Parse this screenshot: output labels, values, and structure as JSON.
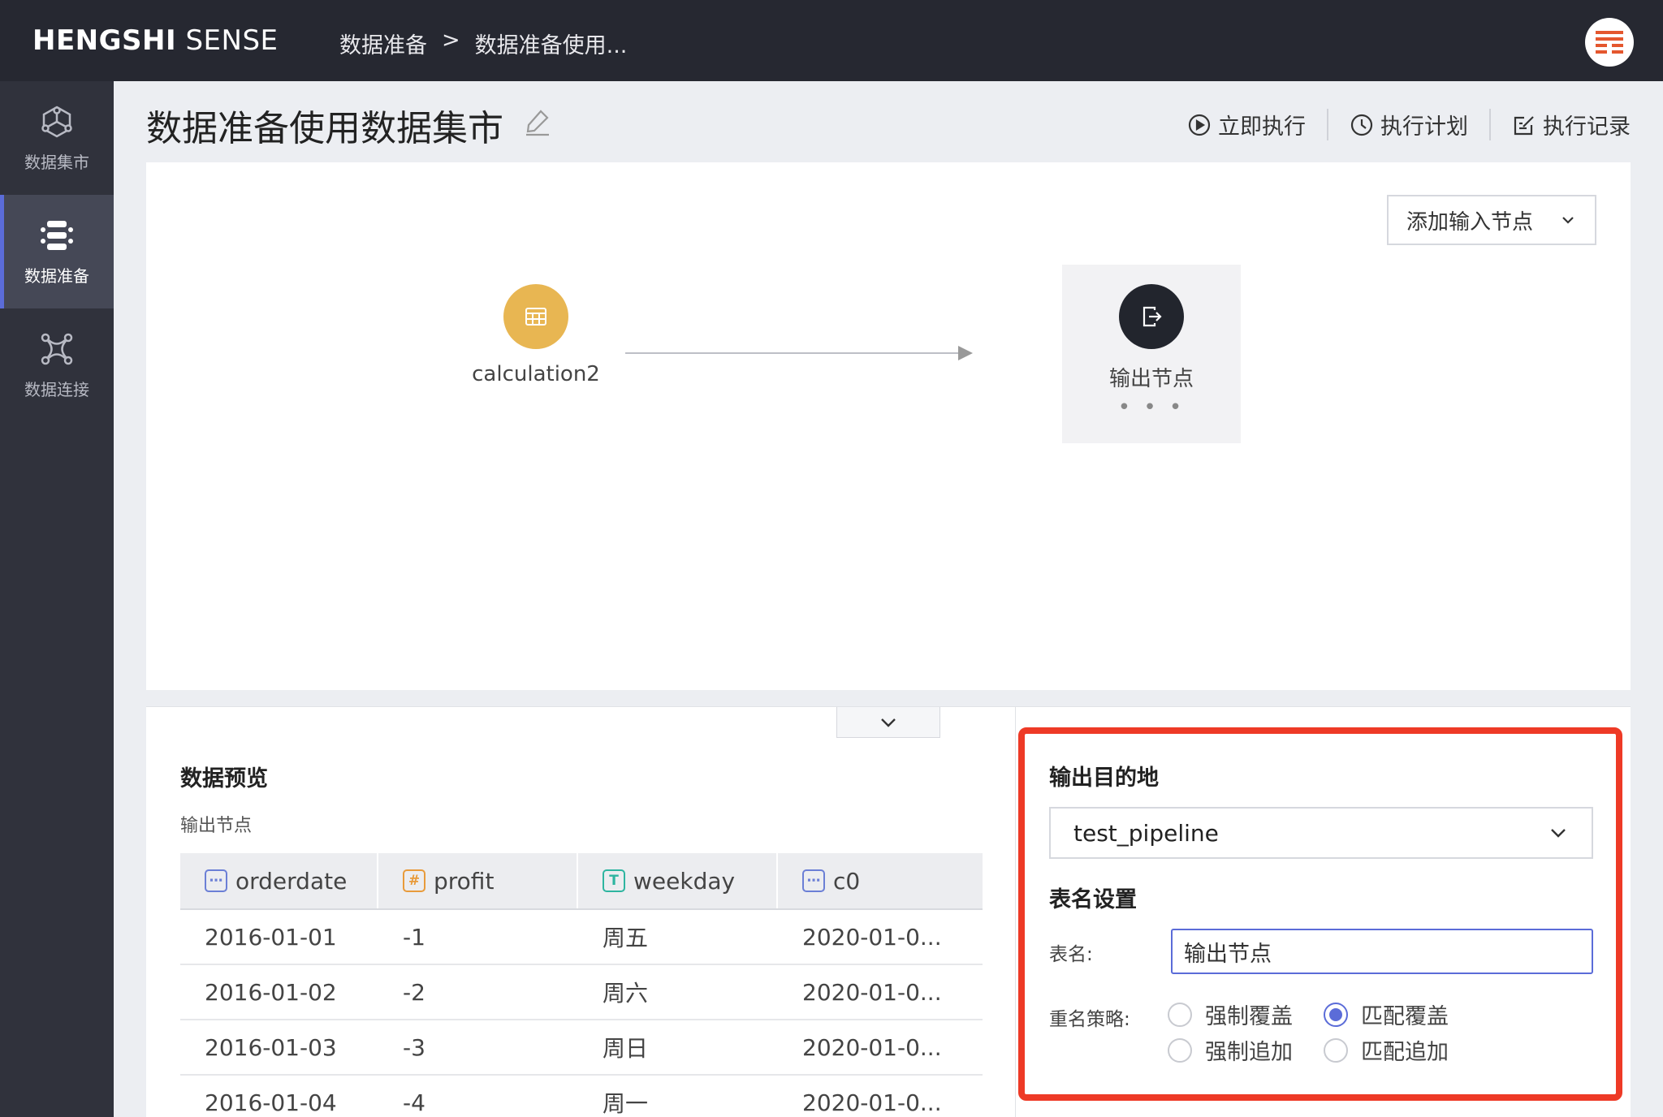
{
  "header": {
    "logo_bold": "HENGSHI",
    "logo_light": " SENSE",
    "breadcrumb": [
      "数据准备",
      ">",
      "数据准备使用..."
    ]
  },
  "sidebar": {
    "items": [
      {
        "label": "数据集市",
        "icon": "data-mart-icon",
        "active": false
      },
      {
        "label": "数据准备",
        "icon": "data-prep-icon",
        "active": true
      },
      {
        "label": "数据连接",
        "icon": "data-connect-icon",
        "active": false
      }
    ]
  },
  "page": {
    "title": "数据准备使用数据集市",
    "actions": {
      "run_now": "立即执行",
      "schedule": "执行计划",
      "history": "执行记录"
    }
  },
  "canvas": {
    "add_input_node": "添加输入节点",
    "nodes": {
      "calc_label": "calculation2",
      "output_label": "输出节点",
      "output_more": "• • •"
    }
  },
  "preview": {
    "title": "数据预览",
    "subtitle": "输出节点",
    "columns": [
      {
        "name": "orderdate",
        "type": "date",
        "type_glyph": "⋯"
      },
      {
        "name": "profit",
        "type": "number",
        "type_glyph": "#"
      },
      {
        "name": "weekday",
        "type": "text",
        "type_glyph": "T"
      },
      {
        "name": "c0",
        "type": "date",
        "type_glyph": "⋯"
      }
    ],
    "rows": [
      [
        "2016-01-01",
        "-1",
        "周五",
        "2020-01-0..."
      ],
      [
        "2016-01-02",
        "-2",
        "周六",
        "2020-01-0..."
      ],
      [
        "2016-01-03",
        "-3",
        "周日",
        "2020-01-0..."
      ],
      [
        "2016-01-04",
        "-4",
        "周一",
        "2020-01-0..."
      ]
    ]
  },
  "settings": {
    "destination_title": "输出目的地",
    "destination_value": "test_pipeline",
    "table_title": "表名设置",
    "table_name_label": "表名:",
    "table_name_value": "输出节点",
    "strategy_label": "重名策略:",
    "strategies": [
      {
        "label": "强制覆盖",
        "selected": false
      },
      {
        "label": "匹配覆盖",
        "selected": true
      },
      {
        "label": "强制追加",
        "selected": false
      },
      {
        "label": "匹配追加",
        "selected": false
      }
    ]
  },
  "colors": {
    "topbar": "#262831",
    "sidebar": "#30323c",
    "accent": "#5b6cd8",
    "highlight_frame": "#ee3a26",
    "calc_node": "#e8b652"
  }
}
